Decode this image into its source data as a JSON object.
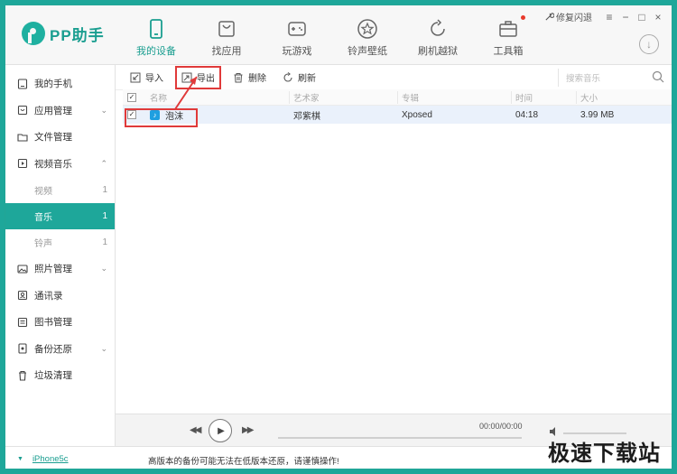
{
  "app": {
    "name": "PP助手"
  },
  "nav": [
    {
      "label": "我的设备",
      "icon": "phone-icon",
      "active": true
    },
    {
      "label": "找应用",
      "icon": "shopping-bag-icon"
    },
    {
      "label": "玩游戏",
      "icon": "gamepad-icon"
    },
    {
      "label": "铃声壁纸",
      "icon": "star-icon"
    },
    {
      "label": "刷机越狱",
      "icon": "refresh-icon"
    },
    {
      "label": "工具箱",
      "icon": "toolbox-icon",
      "badge": true
    }
  ],
  "window": {
    "repair": "修复闪退",
    "menu": "≡",
    "minimize": "−",
    "maximize": "□",
    "close": "×",
    "download": "↓"
  },
  "sidebar": {
    "items": [
      {
        "label": "我的手机",
        "icon": "phone-outline-icon"
      },
      {
        "label": "应用管理",
        "icon": "apps-icon",
        "chevron": "⌄"
      },
      {
        "label": "文件管理",
        "icon": "folder-icon"
      },
      {
        "label": "视频音乐",
        "icon": "video-icon",
        "chevron": "⌃"
      }
    ],
    "subitems": [
      {
        "label": "视频",
        "count": "1"
      },
      {
        "label": "音乐",
        "count": "1",
        "active": true
      },
      {
        "label": "铃声",
        "count": "1"
      }
    ],
    "items2": [
      {
        "label": "照片管理",
        "icon": "photo-icon",
        "chevron": "⌄"
      },
      {
        "label": "通讯录",
        "icon": "contacts-icon"
      },
      {
        "label": "图书管理",
        "icon": "book-icon"
      },
      {
        "label": "备份还原",
        "icon": "backup-icon",
        "chevron": "⌄"
      },
      {
        "label": "垃圾清理",
        "icon": "trash-icon"
      }
    ]
  },
  "toolbar": {
    "import": "导入",
    "export": "导出",
    "delete": "删除",
    "refresh": "刷新",
    "search_placeholder": "搜索音乐"
  },
  "table": {
    "headers": {
      "name": "名称",
      "artist": "艺术家",
      "album": "专辑",
      "time": "时间",
      "size": "大小"
    },
    "rows": [
      {
        "name": "泡沫",
        "artist": "邓紫棋",
        "album": "Xposed",
        "time": "04:18",
        "size": "3.99 MB",
        "checked": true
      }
    ]
  },
  "player": {
    "time": "00:00/00:00",
    "prev": "◀◀",
    "next": "▶▶",
    "play": "▶"
  },
  "status": {
    "device": "iPhone5c",
    "message": "高版本的备份可能无法在低版本还原，请谨慎操作!",
    "watermark": "极速下载站"
  },
  "colors": {
    "accent": "#1ea79a",
    "highlight": "#e03a3a",
    "selected_row": "#eaf1fb"
  }
}
